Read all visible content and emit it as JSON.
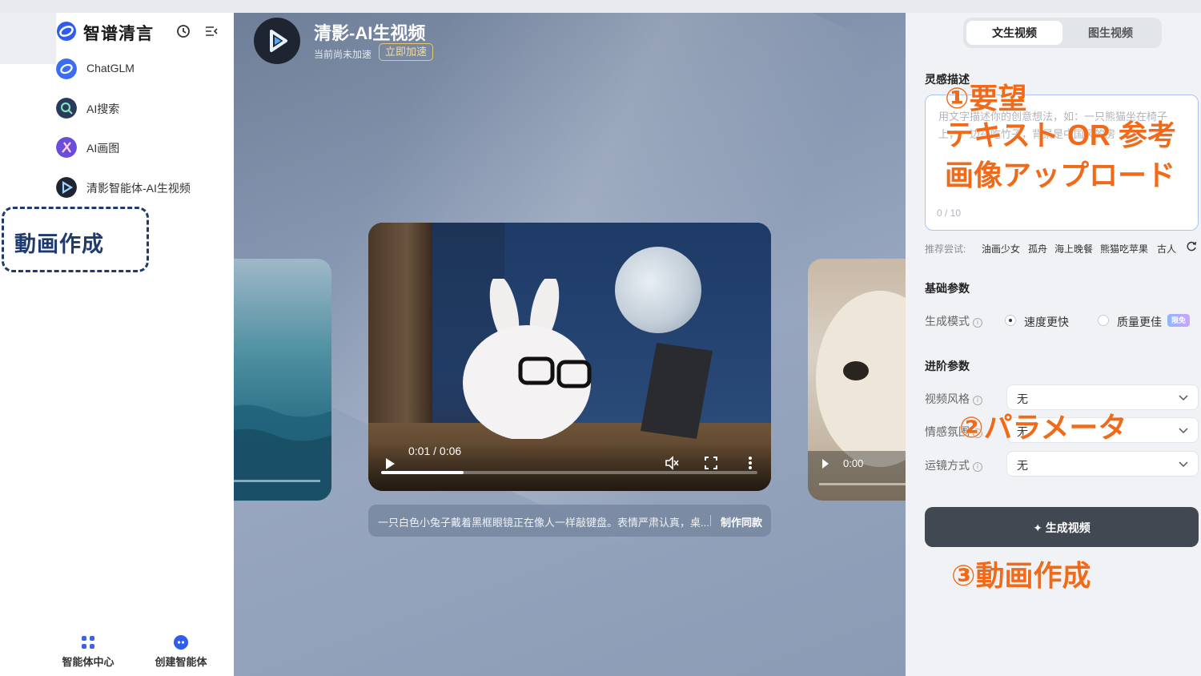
{
  "sidebar": {
    "brand": "智谱清言",
    "nav": [
      {
        "label": "ChatGLM",
        "icon": "chatglm-icon",
        "color": "#3b6df2"
      },
      {
        "label": "AI搜索",
        "icon": "ai-search-icon",
        "color": "#2a3a5a"
      },
      {
        "label": "AI画图",
        "icon": "ai-draw-icon",
        "color": "#6a4dd8"
      },
      {
        "label": "清影智能体-AI生视频",
        "icon": "video-agent-icon",
        "color": "#1f2530"
      }
    ],
    "bottom": [
      {
        "label": "智能体中心",
        "icon": "agent-center-icon"
      },
      {
        "label": "创建智能体",
        "icon": "create-agent-icon"
      }
    ],
    "annotation": "動画作成"
  },
  "stage": {
    "title": "清影-AI生视频",
    "subtitle": "当前尚未加速",
    "speed_button": "立即加速",
    "video": {
      "time": "0:01 / 0:06",
      "progress": 0.22
    },
    "right_video_time": "0:00",
    "caption": "一只白色小兔子戴着黑框眼镜正在像人一样敲键盘。表情严肃认真，桌...",
    "caption_button": "制作同款"
  },
  "panel": {
    "tabs": [
      "文生视频",
      "图生视频"
    ],
    "active_tab": 0,
    "inspiration_label": "灵感描述",
    "prompt_placeholder": "用文字描述你的创意想法，如：一只熊猫坐在椅子上，一边在吃竹子，背景是中国风的房",
    "prompt_count": "0 / 10",
    "suggest_label": "推荐尝试:",
    "suggestions": [
      "油画少女",
      "孤舟",
      "海上晚餐",
      "熊猫吃苹果",
      "古人"
    ],
    "basic_params_label": "基础参数",
    "mode_label": "生成模式",
    "mode_options": [
      "速度更快",
      "质量更佳"
    ],
    "free_badge": "限免",
    "advanced_params_label": "进阶参数",
    "style_label": "视频风格",
    "style_value": "无",
    "mood_label": "情感氛围",
    "mood_value": "无",
    "camera_label": "运镜方式",
    "camera_value": "无",
    "generate_button": "✦ 生成视频"
  },
  "annotations": {
    "step1": "①要望",
    "step1_detail": "テキスト OR 参考画像アップロード",
    "step2": "②パラメータ",
    "step3": "③動画作成"
  },
  "colors": {
    "accent_orange": "#f06a1a",
    "annotation_navy": "#1f3a6e",
    "button_dark": "#414852"
  }
}
